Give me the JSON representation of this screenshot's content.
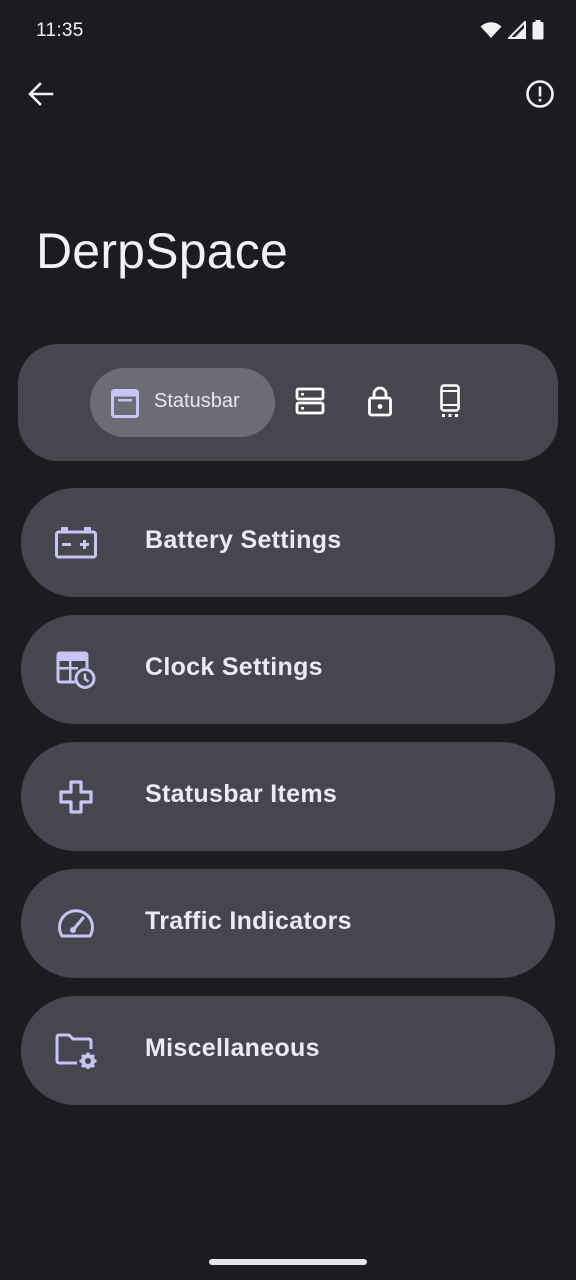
{
  "status_bar": {
    "time": "11:35",
    "icons": [
      "wifi-icon",
      "signal-icon",
      "battery-icon"
    ]
  },
  "app_bar": {
    "back_icon": "arrow-left-icon",
    "info_icon": "alert-circle-icon"
  },
  "page": {
    "title": "DerpSpace"
  },
  "tabs": {
    "selected_label": "Statusbar",
    "items": [
      {
        "icon": "statusbar-icon",
        "label": "Statusbar",
        "selected": true
      },
      {
        "icon": "quick-settings-icon",
        "selected": false
      },
      {
        "icon": "lock-icon",
        "selected": false
      },
      {
        "icon": "phone-icon",
        "selected": false
      }
    ]
  },
  "settings": {
    "items": [
      {
        "icon": "battery-plus-icon",
        "label": "Battery Settings"
      },
      {
        "icon": "clock-calendar-icon",
        "label": "Clock Settings"
      },
      {
        "icon": "plus-outline-icon",
        "label": "Statusbar Items"
      },
      {
        "icon": "speedometer-icon",
        "label": "Traffic Indicators"
      },
      {
        "icon": "folder-settings-icon",
        "label": "Miscellaneous"
      }
    ]
  },
  "colors": {
    "background": "#1b1c20",
    "card": "#46464f",
    "tab_selected": "#6c6c75",
    "accent_icon": "#c6c5f4",
    "text": "#eceaf3"
  }
}
